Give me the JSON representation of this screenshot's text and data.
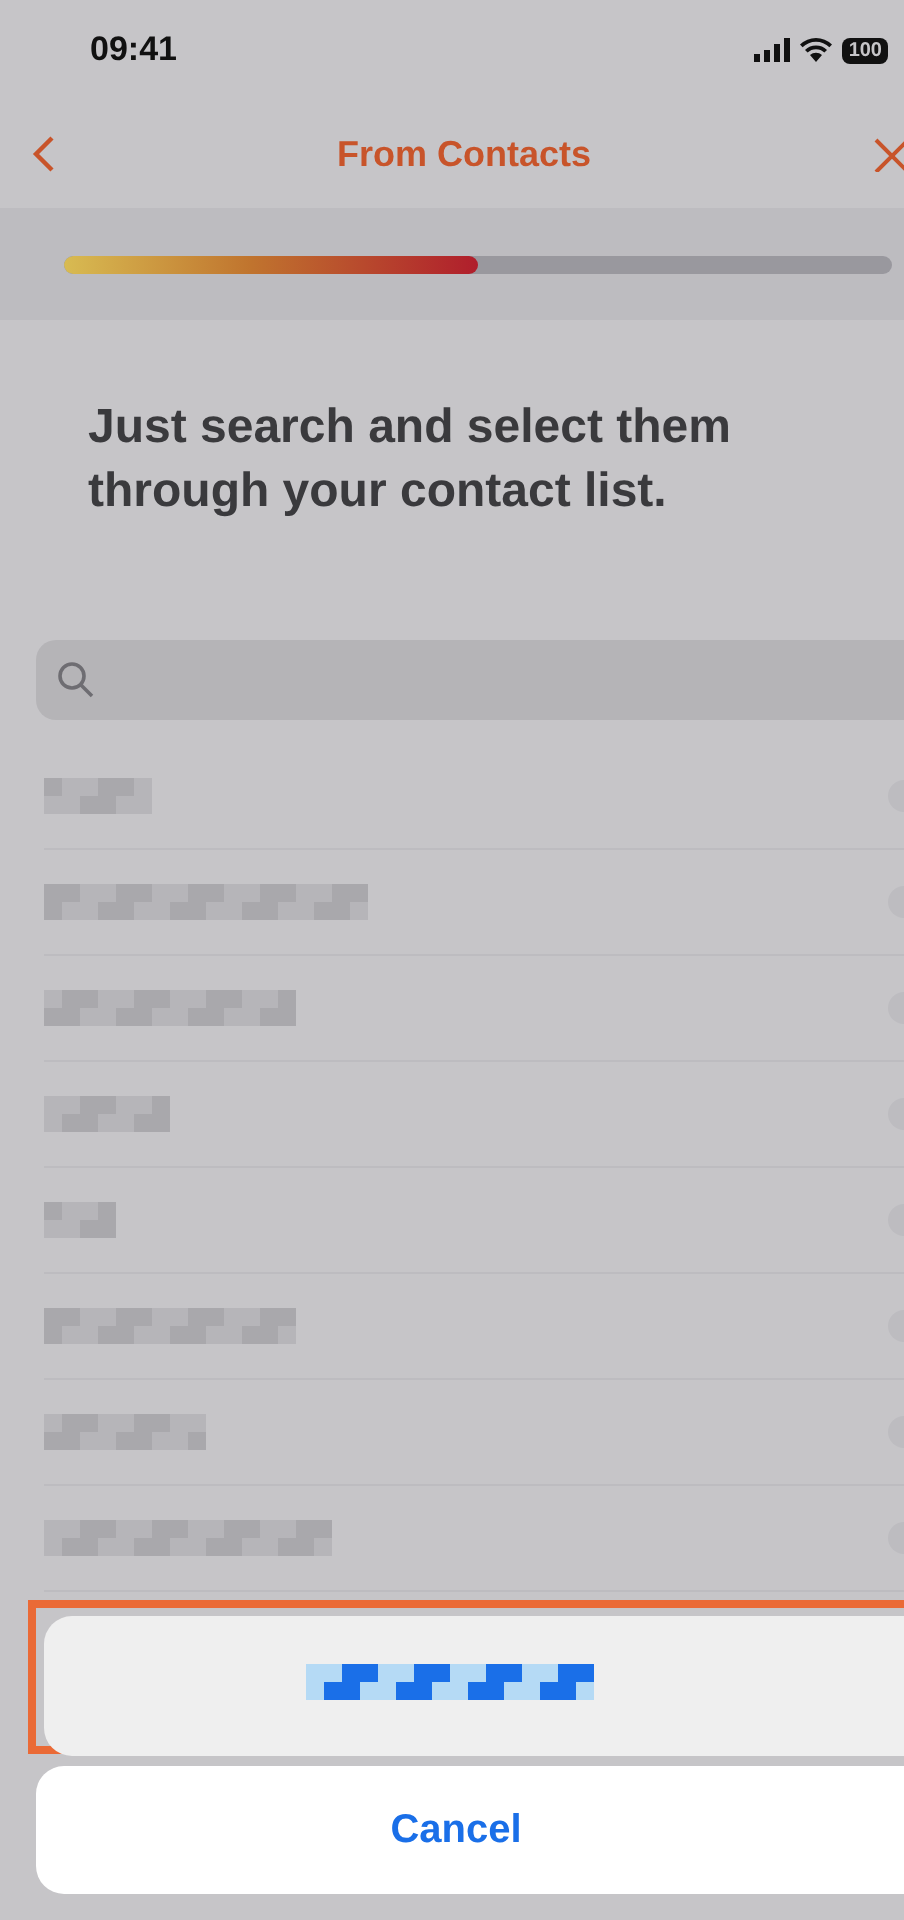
{
  "status_bar": {
    "time": "09:41",
    "battery": "100"
  },
  "nav": {
    "title": "From Contacts"
  },
  "progress": {
    "level": 0.5
  },
  "heading": "Just search and select them through your contact list.",
  "contacts": [
    {
      "kind": "redacted"
    },
    {
      "kind": "redacted"
    },
    {
      "kind": "redacted"
    },
    {
      "kind": "redacted"
    },
    {
      "kind": "redacted"
    },
    {
      "kind": "redacted"
    },
    {
      "kind": "redacted"
    },
    {
      "kind": "redacted"
    }
  ],
  "action_sheet": {
    "action": {
      "kind": "redacted",
      "highlighted": true
    },
    "cancel": "Cancel"
  }
}
